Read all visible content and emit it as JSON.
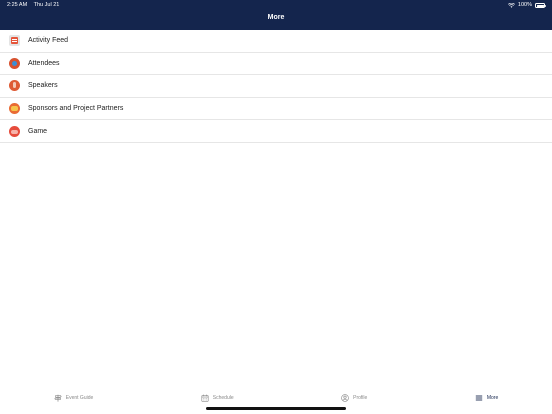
{
  "status_bar": {
    "time": "2:25 AM",
    "date": "Thu Jul 21",
    "battery": "100%"
  },
  "header": {
    "title": "More",
    "background_color": "#14254d"
  },
  "menu": {
    "items": [
      {
        "label": "Activity Feed",
        "icon": "activity-feed-icon"
      },
      {
        "label": "Attendees",
        "icon": "attendees-icon"
      },
      {
        "label": "Speakers",
        "icon": "speakers-icon"
      },
      {
        "label": "Sponsors and Project Partners",
        "icon": "sponsors-icon"
      },
      {
        "label": "Game",
        "icon": "game-controller-icon"
      }
    ]
  },
  "tabbar": {
    "tabs": [
      {
        "label": "Event Guide",
        "icon": "signpost-icon",
        "active": false
      },
      {
        "label": "Schedule",
        "icon": "calendar-icon",
        "active": false
      },
      {
        "label": "Profile",
        "icon": "person-icon",
        "active": false
      },
      {
        "label": "More",
        "icon": "menu-icon",
        "active": true
      }
    ]
  }
}
